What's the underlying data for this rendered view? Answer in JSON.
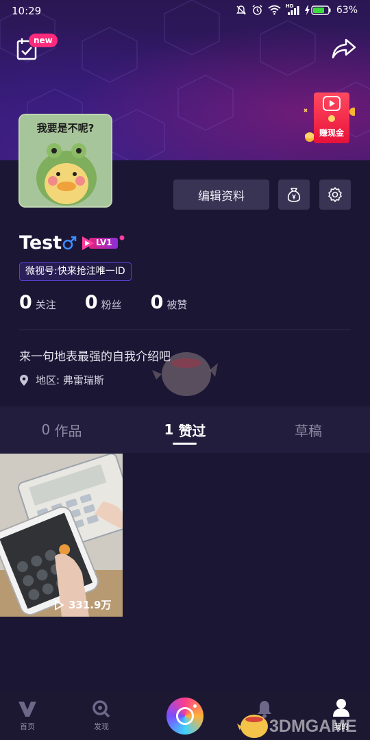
{
  "status_bar": {
    "time": "10:29",
    "network": "HD",
    "battery": "63%"
  },
  "header": {
    "badge": "new",
    "promo_label": "赚现金"
  },
  "profile": {
    "avatar_caption": "我要是不呢?",
    "edit_button": "编辑资料",
    "wallet_icon": "money-bag-icon",
    "settings_icon": "gear-icon",
    "username": "Test",
    "gender": "male",
    "level": "LV1",
    "weishi_id_prefix": "微视号:",
    "weishi_id_value": "快来抢注唯一ID",
    "stats": [
      {
        "num": "0",
        "label": "关注"
      },
      {
        "num": "0",
        "label": "粉丝"
      },
      {
        "num": "0",
        "label": "被赞"
      }
    ],
    "bio": "来一句地表最强的自我介绍吧",
    "region_label": "地区:",
    "region_value": "弗雷瑞斯"
  },
  "tabs": [
    {
      "count": "0",
      "name": "作品",
      "active": false
    },
    {
      "count": "1",
      "name": "赞过",
      "active": true
    },
    {
      "count": "",
      "name": "草稿",
      "active": false
    }
  ],
  "videos": [
    {
      "play_count": "331.9万"
    }
  ],
  "bottom_nav": {
    "home": "首页",
    "discover": "发现",
    "messages": "",
    "me": "我的",
    "watermark": "3DMGAME"
  },
  "colors": {
    "background": "#1b1634",
    "accent_pink": "#ff2a7c",
    "accent_purple": "#5b3fd0",
    "button_bg": "#3a3454"
  }
}
